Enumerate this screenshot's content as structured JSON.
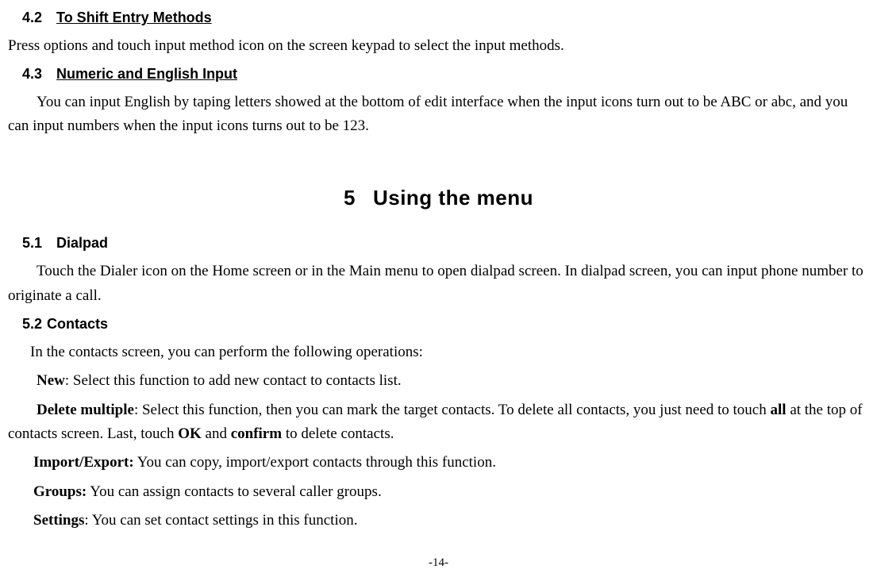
{
  "section42": {
    "num": "4.2",
    "title": "To Shift Entry Methods",
    "body": "Press options and touch input method icon on the screen keypad to select the input methods."
  },
  "section43": {
    "num": "4.3",
    "title": "Numeric and English Input",
    "body": "You can input English by taping letters showed at the bottom of edit interface when the input icons turn out to be ABC or abc, and you can input numbers when the input icons turns out to be 123."
  },
  "chapter5": {
    "num": "5",
    "title": "Using the menu"
  },
  "section51": {
    "num": "5.1",
    "title": "Dialpad",
    "body": "Touch the Dialer icon on the Home screen or in the Main menu to open dialpad screen. In dialpad screen, you can input phone number to originate a call."
  },
  "section52": {
    "num": "5.2",
    "title": "Contacts",
    "intro": "In the contacts screen, you can perform the following operations:",
    "new_label": "New",
    "new_text": ": Select this function to add new contact to contacts list.",
    "delete_label": "Delete multiple",
    "delete_text1": ": Select this function, then you can mark the target contacts. To delete all contacts, you just need to touch ",
    "delete_all": "all",
    "delete_text2": " at the top of contacts screen. Last, touch ",
    "delete_ok": "OK",
    "delete_text3": " and ",
    "delete_confirm": "confirm",
    "delete_text4": " to delete contacts.",
    "import_label": "Import/Export:",
    "import_text": " You can copy, import/export contacts through this function.",
    "groups_label": "Groups:",
    "groups_text": " You can assign contacts to several caller groups.",
    "settings_label": "Settings",
    "settings_text": ": You can set contact settings in this function."
  },
  "page_number": "-14-"
}
